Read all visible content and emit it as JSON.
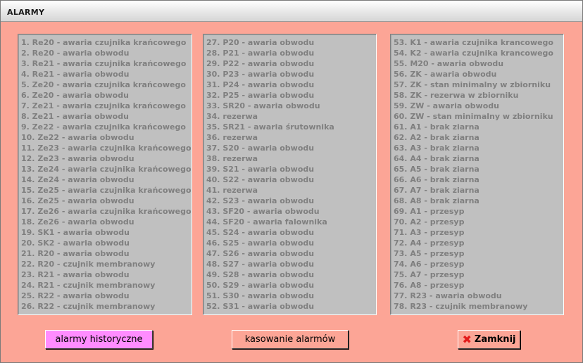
{
  "window": {
    "title": "ALARMY"
  },
  "alarms": {
    "column1": [
      "1. Re20 - awaria czujnika krańcowego",
      "2. Re20 - awaria obwodu",
      "3. Re21 - awaria czujnika krańcowego",
      "4. Re21 - awaria obwodu",
      "5. Ze20 - awaria czujnika krańcowego",
      "6. Ze20 - awaria obwodu",
      "7. Ze21 - awaria czujnika krańcowego",
      "8. Ze21 - awaria obwodu",
      "9. Ze22 - awaria czujnika krańcowego",
      "10. Ze22 - awaria obwodu",
      "11. Ze23 - awaria czujnika krańcowego",
      "12. Ze23 - awaria obwodu",
      "13. Ze24 - awaria czujnika krańcowego",
      "14. Ze24 - awaria obwodu",
      "15. Ze25 - awaria czujnika krańcowego",
      "16. Ze25 - awaria obwodu",
      "17. Ze26 - awaria czujnika krańcowego",
      "18. Ze26 - awaria obwodu",
      "19. SK1 - awaria obwodu",
      "20. SK2 - awaria obwodu",
      "21. R20 - awaria obwodu",
      "22. R20 - czujnik membranowy",
      "23. R21 - awaria obwodu",
      "24. R21 - czujnik membranowy",
      "25. R22 - awaria obwodu",
      "26. R22 - czujnik membranowy"
    ],
    "column2": [
      "27. P20 - awaria obwodu",
      "28. P21 - awaria obwodu",
      "29. P22 - awaria obwodu",
      "30. P23 - awaria obwodu",
      "31. P24 - awaria obwodu",
      "32. P25 - awaria obwodu",
      "33. SR20 - awaria obwodu",
      "34. rezerwa",
      "35. SR21 - awaria śrutownika",
      "36. rezerwa",
      "37. S20 - awaria obwodu",
      "38. rezerwa",
      "39. S21 - awaria obwodu",
      "40. S22 - awaria obwodu",
      "41. rezerwa",
      "42. S23 - awaria obwodu",
      "43. SF20 - awaria obwodu",
      "44. SF20 - awaria falownika",
      "45. S24 - awaria obwodu",
      "46. S25 - awaria obwodu",
      "47. S26 - awaria obwodu",
      "48. S27 - awaria obwodu",
      "49. S28 - awaria obwodu",
      "50. S29 - awaria obwodu",
      "51. S30 - awaria obwodu",
      "52. S31 - awaria obwodu"
    ],
    "column3": [
      "53. K1 - awaria czujnika krancowego",
      "54. K2 - awaria czujnika krancowego",
      "55. M20 - awaria obwodu",
      "56. ZK - awaria obwodu",
      "57. ZK - stan minimalny w zbiorniku",
      "58. ZK - rezerwa w zbiorniku",
      "59. ZW - awaria obwodu",
      "60. ZW - stan minimalny w zbiorniku",
      "61. A1 - brak ziarna",
      "62. A2 - brak ziarna",
      "63. A3 - brak ziarna",
      "64. A4 - brak ziarna",
      "65. A5 - brak ziarna",
      "66. A6 - brak ziarna",
      "67. A7 - brak ziarna",
      "68. A8 - brak ziarna",
      "69. A1 - przesyp",
      "70. A2 - przesyp",
      "71. A3 - przesyp",
      "72. A4 - przesyp",
      "73. A5 - przesyp",
      "74. A6 - przesyp",
      "75. A7 - przesyp",
      "76. A8 - przesyp",
      "77. R23 - awaria obwodu",
      "78. R23 - czujnik membranowy"
    ]
  },
  "buttons": {
    "history_label": "alarmy historyczne",
    "reset_label": "kasowanie alarmów",
    "close_label": "Zamknij",
    "close_icon": "close-x-icon"
  },
  "colors": {
    "window_bg": "#fca596",
    "panel_bg": "#c0c0c0",
    "inactive_text": "#7f7f7f",
    "history_button_bg": "#ff8cff",
    "close_icon_red": "#e31b1b"
  }
}
